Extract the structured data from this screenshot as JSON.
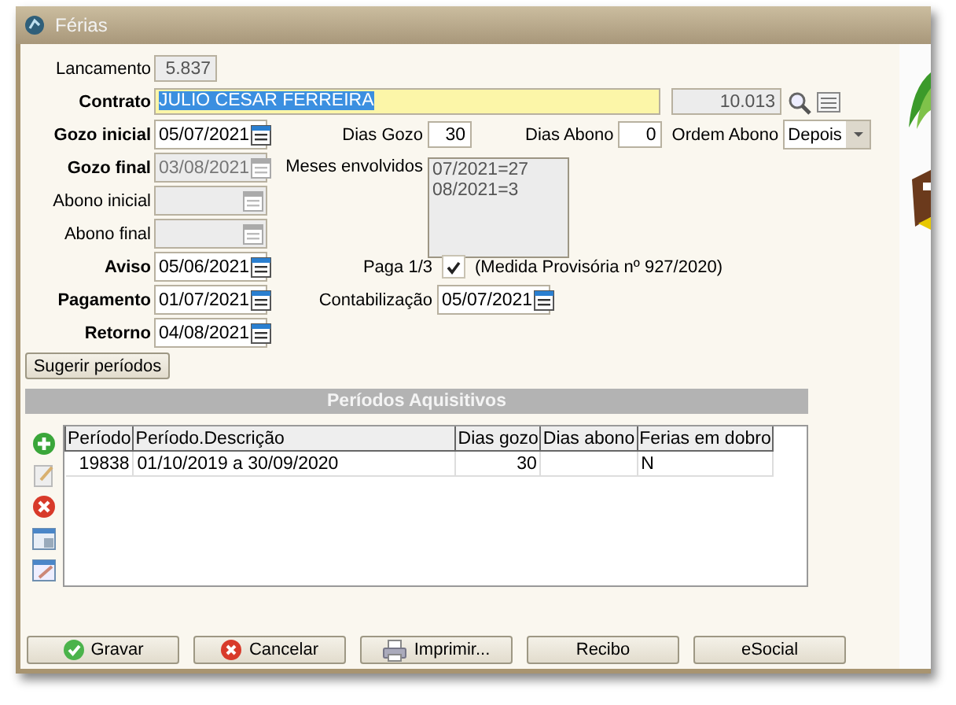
{
  "window": {
    "title": "Férias"
  },
  "lancamento": {
    "label": "Lancamento",
    "value": "5.837"
  },
  "contrato": {
    "label": "Contrato",
    "name": "JULIO CESAR FERREIRA",
    "code": "10.013"
  },
  "rows": [
    {
      "label": "Gozo inicial",
      "emphasis": true,
      "date": {
        "value": "05/07/2021",
        "disabled": false
      },
      "extras": [
        {
          "kind": "number",
          "label": "Dias Gozo",
          "value": "30"
        },
        {
          "kind": "number",
          "label": "Dias Abono",
          "value": "0"
        },
        {
          "kind": "select",
          "label": "Ordem Abono",
          "value": "Depois"
        }
      ]
    },
    {
      "label": "Gozo final",
      "emphasis": true,
      "date": {
        "value": "03/08/2021",
        "disabled": true
      },
      "extras": [
        {
          "kind": "memo",
          "label": "Meses envolvidos",
          "lines": [
            "07/2021=27",
            "08/2021=3"
          ]
        }
      ]
    },
    {
      "label": "Abono inicial",
      "emphasis": false,
      "date": {
        "disabled": true
      }
    },
    {
      "label": "Abono final",
      "emphasis": false,
      "date": {
        "disabled": true
      }
    },
    {
      "label": "Aviso",
      "emphasis": true,
      "date": {
        "value": "05/06/2021",
        "disabled": false
      },
      "extras": [
        {
          "kind": "checkbox",
          "label": "Paga 1/3",
          "checked": true,
          "note": "(Medida Provisória nº 927/2020)"
        }
      ]
    },
    {
      "label": "Pagamento",
      "emphasis": true,
      "date": {
        "value": "01/07/2021",
        "disabled": false
      },
      "extras": [
        {
          "kind": "date",
          "label": "Contabilização",
          "value": "05/07/2021"
        }
      ]
    },
    {
      "label": "Retorno",
      "emphasis": true,
      "date": {
        "value": "04/08/2021",
        "disabled": false
      }
    }
  ],
  "suggest_button": "Sugerir períodos",
  "section_title": "Períodos Aquisitivos",
  "table": {
    "columns": [
      "Período",
      "Período.Descrição",
      "Dias gozo",
      "Dias abono",
      "Ferias em dobro"
    ],
    "rows": [
      [
        "19838",
        "01/10/2019 a 30/09/2020",
        "30",
        "",
        "N"
      ]
    ]
  },
  "buttons": [
    {
      "kind": "save",
      "label": "Gravar"
    },
    {
      "kind": "cancel",
      "label": "Cancelar"
    },
    {
      "kind": "print",
      "label": "Imprimir..."
    },
    {
      "kind": "plain",
      "label": "Recibo"
    },
    {
      "kind": "plain",
      "label": "eSocial"
    }
  ]
}
